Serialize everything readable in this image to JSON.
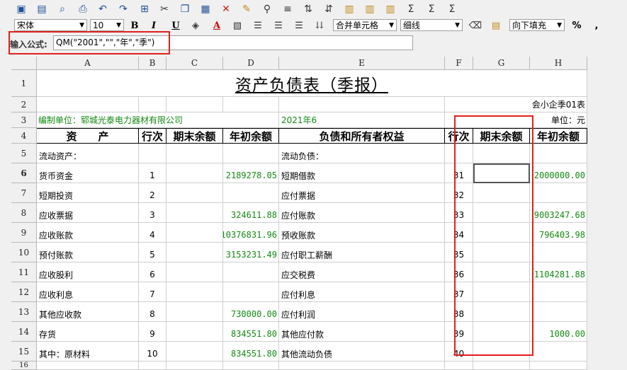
{
  "toolbar": {
    "icons": [
      "save-icon",
      "save-as-icon",
      "print-preview-icon",
      "print-icon",
      "undo-icon",
      "redo-icon",
      "select-all-icon",
      "cut-icon",
      "copy-icon",
      "paste-icon",
      "delete-icon",
      "format-painter-icon",
      "find-icon",
      "edit-formula-icon",
      "sort-ascending-icon",
      "sort-descending-icon",
      "insert-row-icon",
      "insert-column-icon",
      "sum-icon",
      "sum-row-icon",
      "sum-column-icon"
    ],
    "font_name": "宋体",
    "font_size": "10",
    "bold": "B",
    "italic": "I",
    "underline": "U",
    "merge_cells": "合并单元格",
    "border_style": "细线",
    "fill_direction": "向下填充",
    "percent": "%"
  },
  "formula": {
    "label": "输入公式:",
    "value": "QM(\"2001\",\"\",\"年\",\"季\")"
  },
  "columns": [
    "A",
    "B",
    "C",
    "D",
    "E",
    "F",
    "G",
    "H"
  ],
  "rows": [
    "1",
    "2",
    "3",
    "4",
    "5",
    "6",
    "7",
    "8",
    "9",
    "10",
    "11",
    "12",
    "13",
    "14",
    "15",
    "16"
  ],
  "sheet": {
    "title": "资产负债表（季报）",
    "form_code": "会小企季01表",
    "unit_label": "单位：元",
    "company": "编制单位：郓城光泰电力器材有限公司",
    "period": "2021年6",
    "headers": {
      "asset": "资　　产",
      "line_no": "行次",
      "end_balance": "期末余额",
      "begin_balance": "年初余额",
      "liability": "负债和所有者权益",
      "line_no2": "行次",
      "end_balance2": "期末余额",
      "begin_balance2": "年初余额"
    },
    "body": [
      {
        "a": "流动资产：",
        "b": "",
        "c": "",
        "d": "",
        "e": "流动负债：",
        "f": "",
        "g": "",
        "h": ""
      },
      {
        "a": "货币资金",
        "b": "1",
        "c": "",
        "d": "2189278.05",
        "e": "短期借款",
        "f": "31",
        "g": "",
        "h": "2000000.00"
      },
      {
        "a": "短期投资",
        "b": "2",
        "c": "",
        "d": "",
        "e": "应付票据",
        "f": "32",
        "g": "",
        "h": ""
      },
      {
        "a": "应收票据",
        "b": "3",
        "c": "",
        "d": "324611.88",
        "e": "应付账款",
        "f": "33",
        "g": "",
        "h": "9003247.68"
      },
      {
        "a": "应收账款",
        "b": "4",
        "c": "",
        "d": "10376831.96",
        "e": "预收账款",
        "f": "34",
        "g": "",
        "h": "796403.98"
      },
      {
        "a": "预付账款",
        "b": "5",
        "c": "",
        "d": "3153231.49",
        "e": "应付职工薪酬",
        "f": "35",
        "g": "",
        "h": ""
      },
      {
        "a": "应收股利",
        "b": "6",
        "c": "",
        "d": "",
        "e": "应交税费",
        "f": "36",
        "g": "",
        "h": "1104281.88"
      },
      {
        "a": "应收利息",
        "b": "7",
        "c": "",
        "d": "",
        "e": "应付利息",
        "f": "37",
        "g": "",
        "h": ""
      },
      {
        "a": "其他应收款",
        "b": "8",
        "c": "",
        "d": "730000.00",
        "e": "应付利润",
        "f": "38",
        "g": "",
        "h": ""
      },
      {
        "a": "存货",
        "b": "9",
        "c": "",
        "d": "834551.80",
        "e": "其他应付款",
        "f": "39",
        "g": "",
        "h": "1000.00"
      },
      {
        "a": "其中：原材料",
        "b": "10",
        "c": "",
        "d": "834551.80",
        "e": "其他流动负债",
        "f": "40",
        "g": "",
        "h": ""
      }
    ]
  }
}
